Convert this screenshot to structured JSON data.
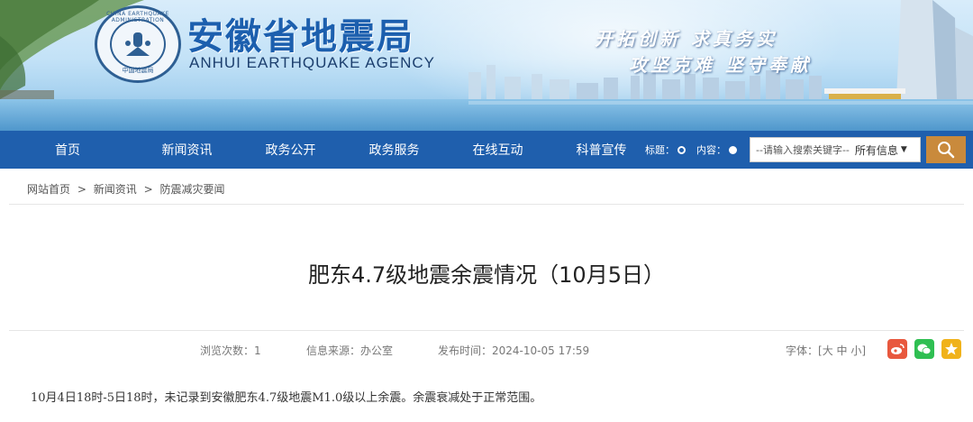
{
  "header": {
    "site_title": "安徽省地震局",
    "site_subtitle": "ANHUI EARTHQUAKE AGENCY",
    "emblem_top_text": "CHINA EARTHQUAKE ADMINISTRATION",
    "emblem_bottom_text": "中国地震局",
    "slogan_line1": "开拓创新 求真务实",
    "slogan_line2": "攻坚克难 坚守奉献"
  },
  "nav": {
    "items": [
      "首页",
      "新闻资讯",
      "政务公开",
      "政务服务",
      "在线互动",
      "科普宣传"
    ]
  },
  "search": {
    "radio_title_label": "标题：",
    "radio_content_label": "内容：",
    "input_placeholder": "--请输入搜索关键字--",
    "select_value": "所有信息",
    "button_icon": "search-icon"
  },
  "breadcrumb": {
    "items": [
      "网站首页",
      "新闻资讯",
      "防震减灾要闻"
    ],
    "separator": ">"
  },
  "article": {
    "title": "肥东4.7级地震余震情况（10月5日）",
    "views_label": "浏览次数：",
    "views_value": "1",
    "source_label": "信息来源：",
    "source_value": "办公室",
    "date_label": "发布时间：",
    "date_value": "2024-10-05 17:59",
    "font_label": "字体：",
    "font_options": "[大 中 小]",
    "body": "10月4日18时-5日18时，未记录到安徽肥东4.7级地震M1.0级以上余震。余震衰减处于正常范围。"
  },
  "share": {
    "icons": [
      "weibo-icon",
      "wechat-icon",
      "qzone-icon"
    ]
  },
  "colors": {
    "nav_bg": "#1f5fad",
    "title_blue": "#1c5fae",
    "search_button": "#c98a3c"
  }
}
